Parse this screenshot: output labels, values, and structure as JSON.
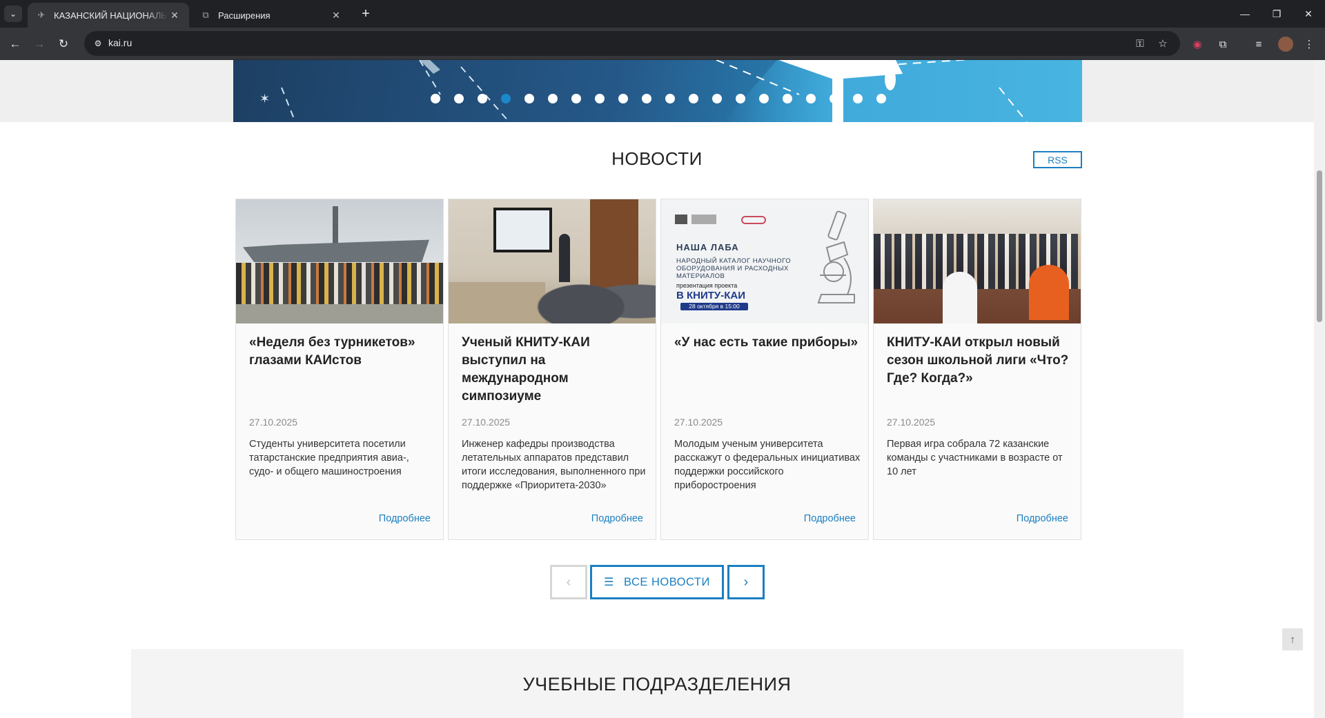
{
  "browser": {
    "tabs": [
      {
        "title": "КАЗАНСКИЙ НАЦИОНАЛЬНЫЙ",
        "active": true
      },
      {
        "title": "Расширения",
        "active": false
      }
    ],
    "url": "kai.ru"
  },
  "carousel": {
    "slide_count": 20,
    "active_index": 3
  },
  "news": {
    "title": "НОВОСТИ",
    "rss_label": "RSS",
    "cards": [
      {
        "heading": "«Неделя без турникетов» глазами КАИстов",
        "date": "27.10.2025",
        "description": "Студенты университета посетили татарстанские предприятия авиа-, судо- и общего машиностроения",
        "more": "Подробнее"
      },
      {
        "heading": "Ученый КНИТУ-КАИ выступил на международном симпозиуме",
        "date": "27.10.2025",
        "description": "Инженер кафедры производства летательных аппаратов представил итоги исследования, выполненного при поддержке «Приоритета-2030»",
        "more": "Подробнее"
      },
      {
        "heading": "«У нас есть такие приборы»",
        "date": "27.10.2025",
        "description": "Молодым ученым университета расскажут о федеральных инициативах поддержки российского приборостроения",
        "more": "Подробнее",
        "poster": {
          "title": "НАША ЛАБА",
          "subtitle": "НАРОДНЫЙ КАТАЛОГ НАУЧНОГО ОБОРУДОВАНИЯ И РАСХОДНЫХ МАТЕРИАЛОВ",
          "line1": "презентация проекта",
          "line2": "В КНИТУ-КАИ",
          "line3": "28 октября в 15:00"
        }
      },
      {
        "heading": "КНИТУ-КАИ открыл новый сезон школьной лиги «Что? Где? Когда?»",
        "date": "27.10.2025",
        "description": "Первая игра собрала 72 казанские команды с участниками в возрасте от 10 лет",
        "more": "Подробнее"
      }
    ],
    "all_news_label": "ВСЕ НОВОСТИ"
  },
  "units": {
    "title": "УЧЕБНЫЕ ПОДРАЗДЕЛЕНИЯ"
  },
  "icons": {
    "prev": "chevron-left-icon",
    "next": "chevron-right-icon",
    "list": "list-icon",
    "to_top": "arrow-up-icon"
  }
}
